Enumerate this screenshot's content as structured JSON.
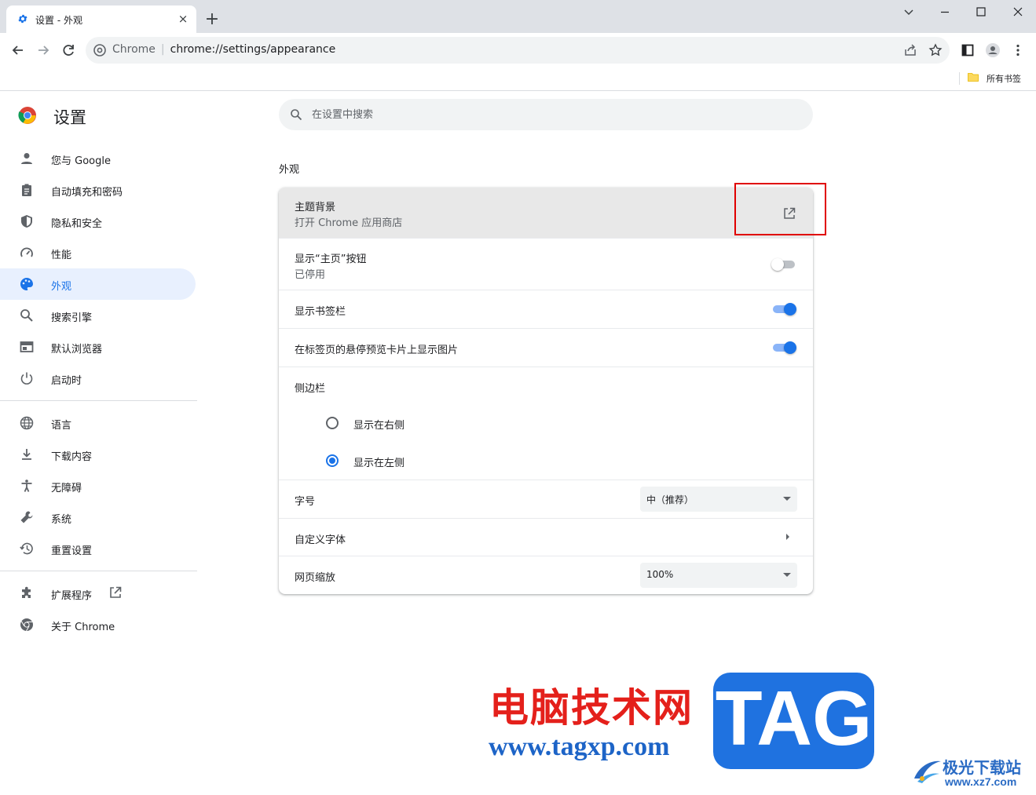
{
  "tab": {
    "title": "设置 - 外观",
    "close": "×",
    "new_tab": "+"
  },
  "omnibox": {
    "host": "Chrome",
    "separator": "|",
    "url": "chrome://settings/appearance"
  },
  "bookmarks": {
    "folder_label": "所有书签"
  },
  "header": {
    "title": "设置"
  },
  "search": {
    "placeholder": "在设置中搜索"
  },
  "sidebar": {
    "items": [
      {
        "label": "您与 Google",
        "icon": "person-icon"
      },
      {
        "label": "自动填充和密码",
        "icon": "clipboard-icon"
      },
      {
        "label": "隐私和安全",
        "icon": "shield-icon"
      },
      {
        "label": "性能",
        "icon": "speedometer-icon"
      },
      {
        "label": "外观",
        "icon": "palette-icon",
        "active": true
      },
      {
        "label": "搜索引擎",
        "icon": "search-icon"
      },
      {
        "label": "默认浏览器",
        "icon": "browser-icon"
      },
      {
        "label": "启动时",
        "icon": "power-icon"
      },
      {
        "label": "语言",
        "icon": "globe-icon"
      },
      {
        "label": "下载内容",
        "icon": "download-icon"
      },
      {
        "label": "无障碍",
        "icon": "accessibility-icon"
      },
      {
        "label": "系统",
        "icon": "wrench-icon"
      },
      {
        "label": "重置设置",
        "icon": "history-icon"
      },
      {
        "label": "扩展程序",
        "icon": "puzzle-icon"
      },
      {
        "label": "关于 Chrome",
        "icon": "chrome-icon"
      }
    ]
  },
  "main": {
    "section_title": "外观",
    "theme": {
      "label": "主题背景",
      "sublabel": "打开 Chrome 应用商店"
    },
    "home_button": {
      "label": "显示“主页”按钮",
      "sublabel": "已停用",
      "enabled": false
    },
    "bookmarks_bar": {
      "label": "显示书签栏",
      "enabled": true
    },
    "hover_preview": {
      "label": "在标签页的悬停预览卡片上显示图片",
      "enabled": true
    },
    "side_panel": {
      "label": "侧边栏",
      "options": [
        {
          "label": "显示在右侧",
          "selected": false
        },
        {
          "label": "显示在左侧",
          "selected": true
        }
      ]
    },
    "font_size": {
      "label": "字号",
      "value": "中（推荐）"
    },
    "custom_fonts": {
      "label": "自定义字体"
    },
    "page_zoom": {
      "label": "网页缩放",
      "value": "100%"
    }
  },
  "watermark": {
    "site_cn": "电脑技术网",
    "site_url": "www.tagxp.com",
    "tag": "TAG",
    "jg_name": "极光下载站",
    "jg_url": "www.xz7.com"
  },
  "colors": {
    "accent": "#1a73e8",
    "active_bg": "#e8f0fe",
    "highlight_box": "#e00000"
  }
}
